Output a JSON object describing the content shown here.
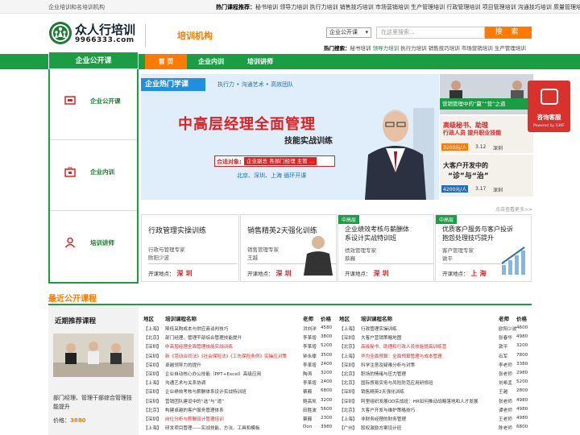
{
  "topbar": {
    "left": "企业培训和名培训机构",
    "recommend_label": "热门课程推荐：",
    "recommend_items": "秘书培训 领导力培训 执行力培训 销售技巧培训 市场营销培训 生产管理培训 行政管理培训 项目管理培训 沟通技巧培训 质量管理培训"
  },
  "logo": {
    "name": "众人行培训",
    "url": "9966333.com"
  },
  "category_title": "培训机构",
  "search": {
    "select": "企业公开课",
    "placeholder": "在这里搜索...",
    "button": "搜 索"
  },
  "hot_search": {
    "label": "热门搜索：",
    "highlight": "秘书培训 领导力培训",
    "items": "执行力培训 销售技巧培训 市场营销培训 生产管理培训"
  },
  "nav": {
    "side_title": "企业公开课",
    "home": "首 页",
    "items": [
      "企业内训",
      "培训讲师"
    ]
  },
  "sidebar": {
    "items": [
      "企业公开课",
      "企业内训",
      "培训讲师"
    ]
  },
  "banner": {
    "tag": "企业热门学课",
    "sub": "执行力 • 沟通艺术 • 高效团队",
    "title": "中高层经理全面管理",
    "subtitle": "技能实战训练",
    "target_label": "合适对象:",
    "target_value": "企业副总 各部门经理 主管 …",
    "cities": "北京、深圳、上海 循环开课"
  },
  "thumbs": [
    {
      "title": "营销管理中的“赢”“营”之道",
      "lines": [
        "",
        ""
      ]
    },
    {
      "title": "高级秘书、助理",
      "title2": "行政人员 提升职业技能",
      "price": "3200元/人",
      "date": "3.12",
      "city": "深圳"
    },
    {
      "title": "大客户开发中的",
      "title2": "“诊”与“治”",
      "price": "4200元/人",
      "date": "3.17",
      "city": "深圳"
    }
  ],
  "more": "点击查看更多>>",
  "float_service": {
    "label": "咨询客服",
    "powered": "Powered by 53KF"
  },
  "cards": [
    {
      "title": "行政管理实操训练",
      "sub": "行政与管理专家",
      "name": "欧阳少波",
      "loc_label": "开课地点：",
      "loc": "深圳"
    },
    {
      "title": "销售精英2天强化训练",
      "sub": "销售管理专家",
      "name": "王越",
      "loc_label": "开课地点：",
      "loc": "深圳"
    },
    {
      "badge": "中高层",
      "title": "企业绩效考核与薪酬体",
      "title2": "系设计实战特训班",
      "sub": "绩效管理专家",
      "name": "蔡巍",
      "loc_label": "开课地点：",
      "loc": "深圳"
    },
    {
      "badge": "中高层",
      "title": "优质客户服务与客户投诉",
      "title2": "抱怨处理技巧提升",
      "sub": "客户管理专家",
      "name": "敦平",
      "loc_label": "开课地点：",
      "loc": "上海"
    }
  ],
  "section_title": "最近公开课程",
  "recommend": {
    "heading": "近期推荐课程",
    "desc": "部门经理、管理干部综合管理技能提升",
    "price_label": "价格：",
    "price": "3880"
  },
  "table_headers": {
    "area": "地区",
    "course": "培训课程名称",
    "teacher": "老师",
    "price": "价格"
  },
  "table_left": [
    {
      "area": "【上海】",
      "course": "降低采购成本与供应商谈判技巧",
      "teacher": "洪刘洋",
      "price": "4580",
      "style": ""
    },
    {
      "area": "【北京】",
      "course": "部门经理、管理干部综合管理技能提升",
      "teacher": "李革增",
      "price": "3800",
      "style": ""
    },
    {
      "area": "【深圳】",
      "course": "中高层经理全面管理技能实战训练",
      "teacher": "李革增",
      "price": "5200",
      "style": "red"
    },
    {
      "area": "【深圳】",
      "course": "新《劳动合同法》《社会保险法》《工伤保险条例》实操应对策",
      "teacher": "钟永棣",
      "price": "3500",
      "style": "red"
    },
    {
      "area": "【深圳】",
      "course": "卓越领导力的提升",
      "teacher": "李革增",
      "price": "2400",
      "style": ""
    },
    {
      "area": "【深圳】",
      "course": "企业自动核心办公技能（PPT+Excel）高级应用",
      "teacher": "陶涛",
      "price": "3200",
      "style": ""
    },
    {
      "area": "【上海】",
      "course": "沟通艺术与关系协调",
      "teacher": "李革增",
      "price": "2400",
      "style": ""
    },
    {
      "area": "【深圳】",
      "course": "企业绩效考核与薪酬体系设计实战特训班",
      "teacher": "蔡巍",
      "price": "6800",
      "style": ""
    },
    {
      "area": "【深圳】",
      "course": "营销团队建设中的“选”与“遣”",
      "teacher": "鲍高凯",
      "price": "3200",
      "style": ""
    },
    {
      "area": "【北京】",
      "course": "构建卓越的客户服务管理体系",
      "teacher": "田胜波",
      "price": "5600",
      "style": ""
    },
    {
      "area": "【深圳】",
      "course": "岗位分析与薪酬设计管理培训",
      "teacher": "蔡巍",
      "price": "2300",
      "style": "red"
    },
    {
      "area": "【上海】",
      "course": "研发项目管理——实战技能、方法、工具和模板",
      "teacher": "Don",
      "price": "3980",
      "style": ""
    }
  ],
  "table_right": [
    {
      "area": "【上海】",
      "course": "行政管理实操训练",
      "teacher": "欧阳少波",
      "price": "4600",
      "style": ""
    },
    {
      "area": "【深圳】",
      "course": "大客户营销策略地图",
      "teacher": "张春华",
      "price": "4980",
      "style": ""
    },
    {
      "area": "【北京】",
      "course": "高级秘书、助理和行政人员技能提高训练营",
      "teacher": "敦平",
      "price": "3200",
      "style": "red"
    },
    {
      "area": "【上海】",
      "course": "华为全面预算：全面预算管理与成本管理",
      "teacher": "石军",
      "price": "7800",
      "style": "red"
    },
    {
      "area": "【深圳】",
      "course": "科学注意及疑难分析与对策",
      "teacher": "李老师",
      "price": "3380",
      "style": ""
    },
    {
      "area": "【北京】",
      "course": "职场的情绪与压力管理",
      "teacher": "张老师",
      "price": "2980",
      "style": ""
    },
    {
      "area": "【北京】",
      "course": "国际贸易实务与风险防范应用研修班",
      "teacher": "刘希孟",
      "price": "5200",
      "style": ""
    },
    {
      "area": "【深圳】",
      "course": "销售精英2天强化训练",
      "teacher": "王越",
      "price": "2800",
      "style": ""
    },
    {
      "area": "【深圳】",
      "course": "阿里组织发展OD实战班：HR如何推动战略落地和人才发展",
      "teacher": "张老师",
      "price": "4980",
      "style": ""
    },
    {
      "area": "【北京】",
      "course": "大客户开发与维护策略技巧",
      "teacher": "谭老师",
      "price": "4980",
      "style": ""
    },
    {
      "area": "【上海】",
      "course": "非财务经理的财务管理",
      "teacher": "王老师",
      "price": "4980",
      "style": ""
    },
    {
      "area": "【广州】",
      "course": "股权激励方案设计班",
      "teacher": "陈老师",
      "price": "6800",
      "style": ""
    }
  ]
}
